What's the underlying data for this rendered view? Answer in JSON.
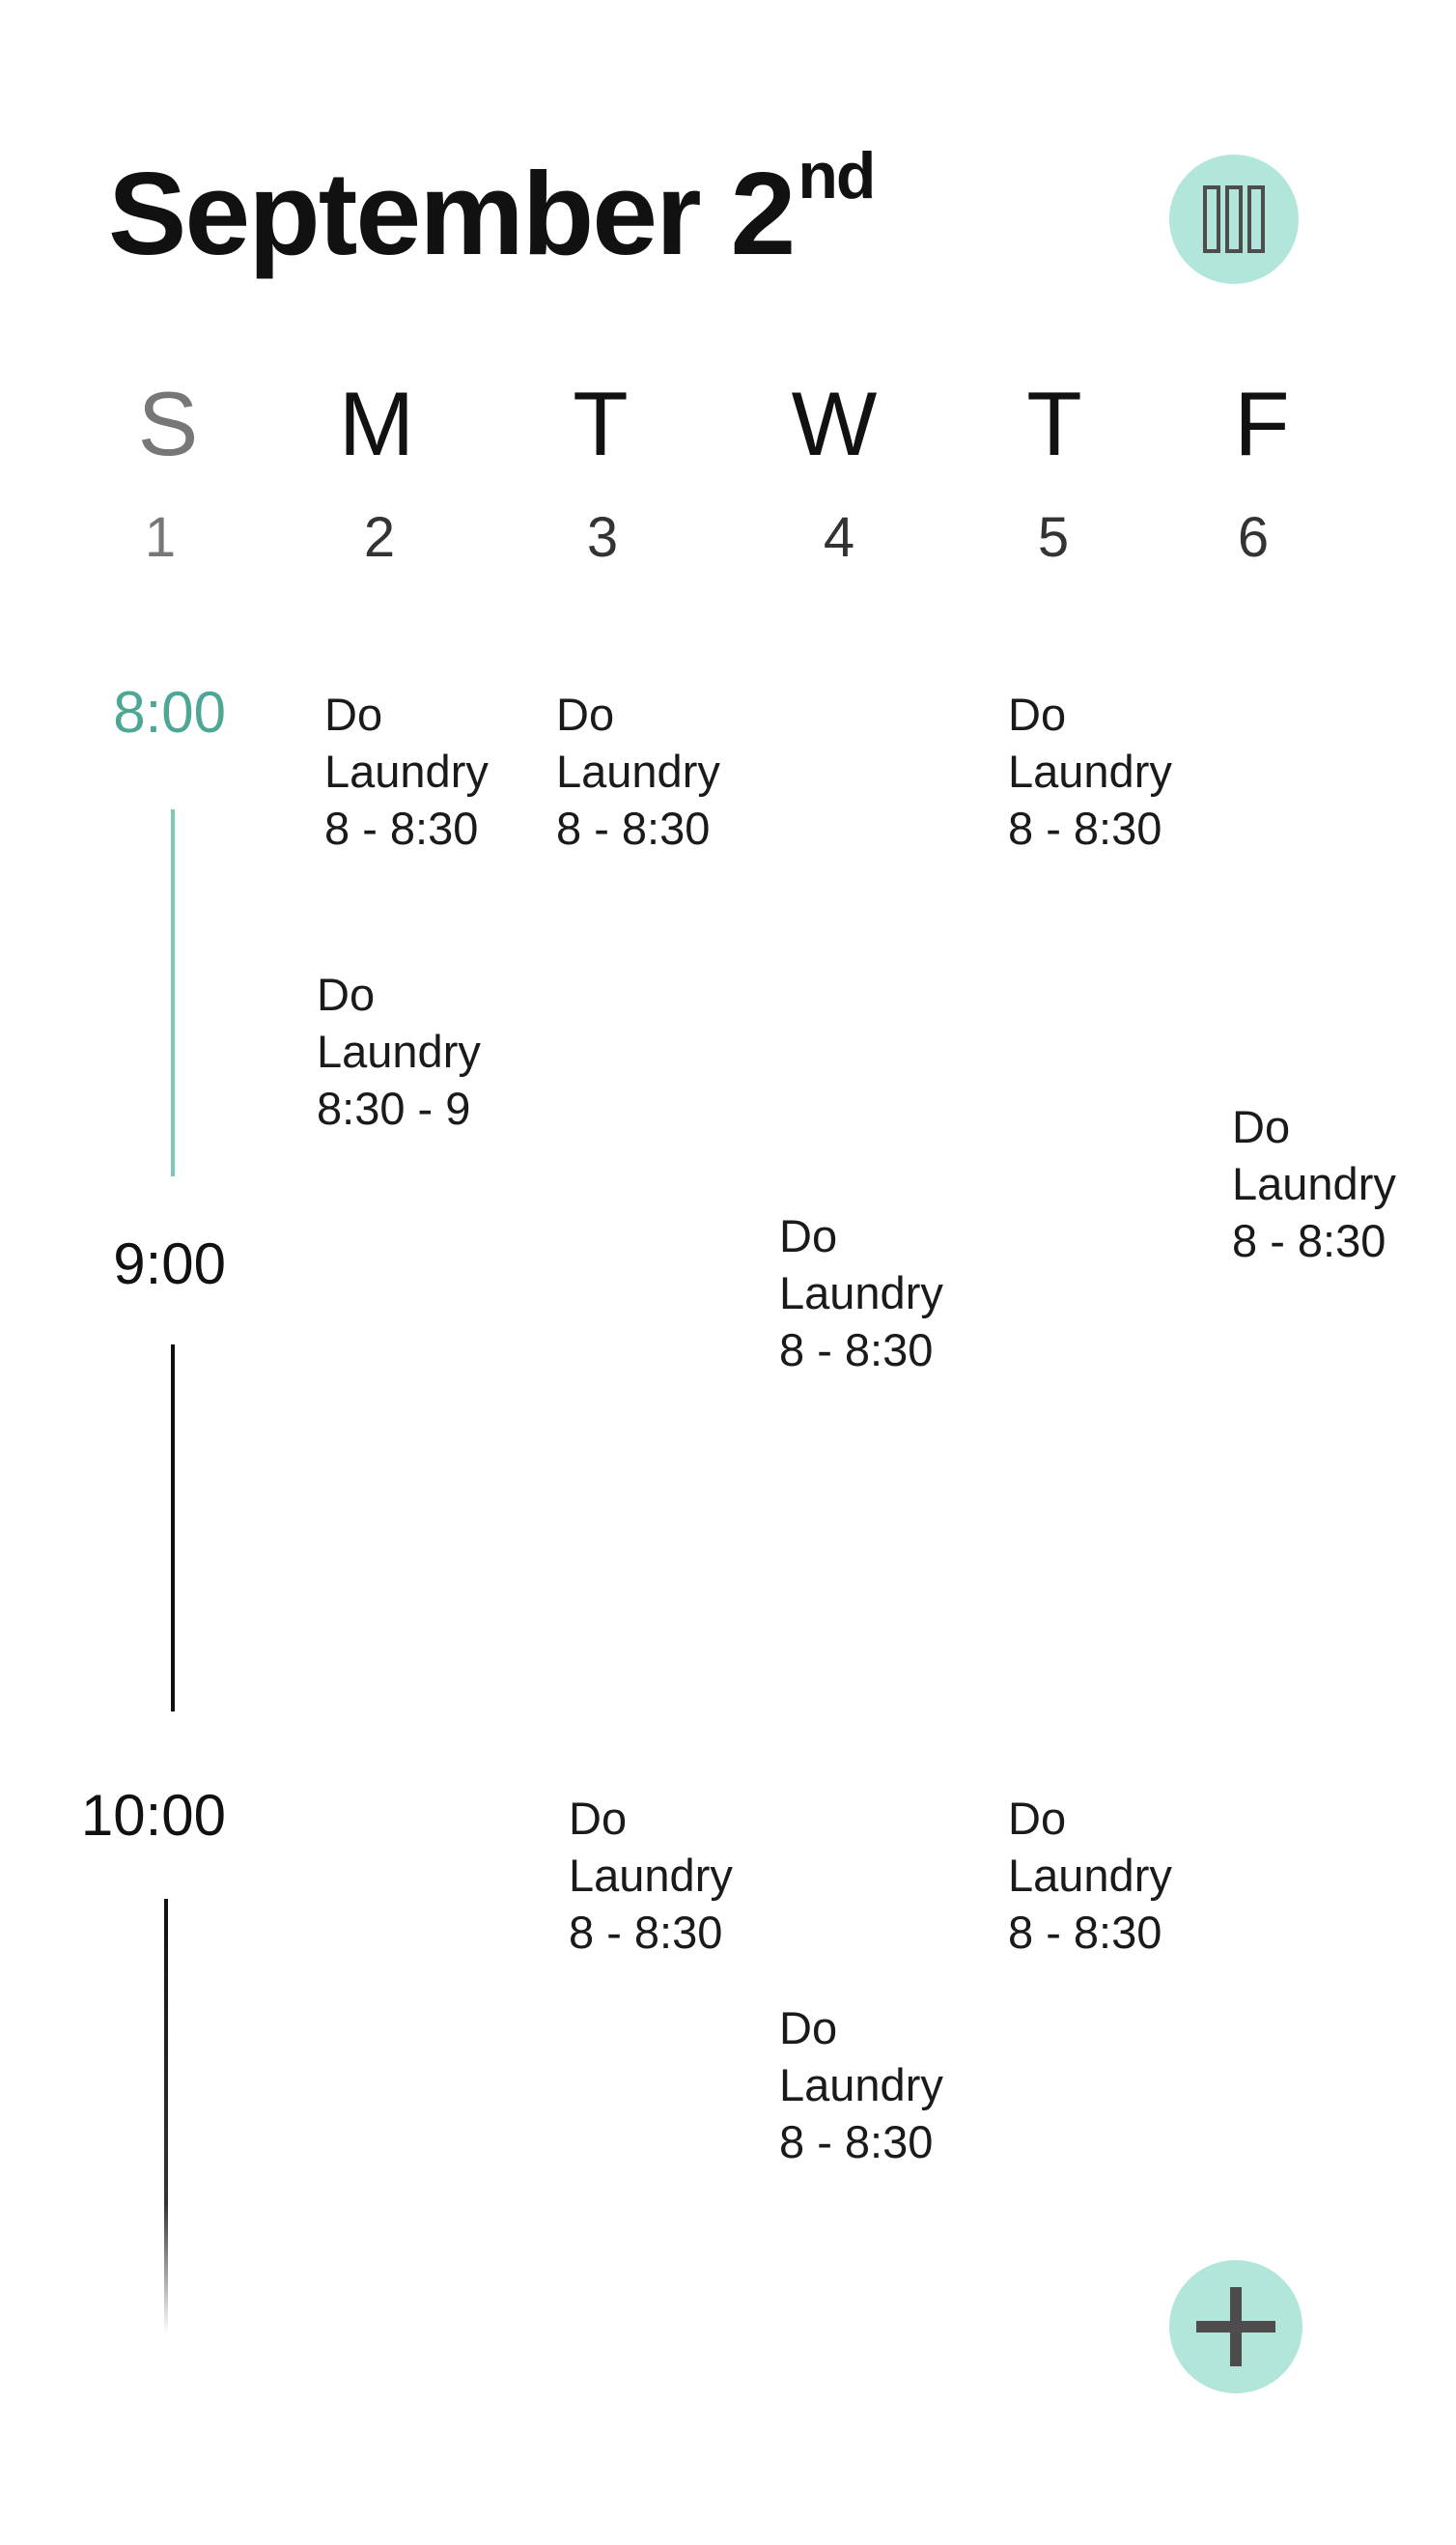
{
  "header": {
    "month_day": "September 2",
    "ordinal_suffix": "nd",
    "view_button_icon": "columns-icon"
  },
  "days": [
    {
      "letter": "S",
      "number": "1",
      "muted": true
    },
    {
      "letter": "M",
      "number": "2"
    },
    {
      "letter": "T",
      "number": "3"
    },
    {
      "letter": "W",
      "number": "4"
    },
    {
      "letter": "T",
      "number": "5"
    },
    {
      "letter": "F",
      "number": "6"
    }
  ],
  "times": [
    {
      "label": "8:00",
      "current": true
    },
    {
      "label": "9:00"
    },
    {
      "label": "10:00"
    }
  ],
  "events": [
    {
      "title_line1": "Do",
      "title_line2": "Laundry",
      "time": "8 - 8:30"
    },
    {
      "title_line1": "Do",
      "title_line2": "Laundry",
      "time": "8 - 8:30"
    },
    {
      "title_line1": "Do",
      "title_line2": "Laundry",
      "time": "8 - 8:30"
    },
    {
      "title_line1": "Do",
      "title_line2": "Laundry",
      "time": "8:30 - 9"
    },
    {
      "title_line1": "Do",
      "title_line2": "Laundry",
      "time": "8 - 8:30"
    },
    {
      "title_line1": "Do",
      "title_line2": "Laundry",
      "time": "8 - 8:30"
    },
    {
      "title_line1": "Do",
      "title_line2": "Laundry",
      "time": "8 - 8:30"
    },
    {
      "title_line1": "Do",
      "title_line2": "Laundry",
      "time": "8 - 8:30"
    },
    {
      "title_line1": "Do",
      "title_line2": "Laundry",
      "time": "8 - 8:30"
    }
  ],
  "colors": {
    "accent": "#4ea694",
    "button_bg": "#b2e6da",
    "icon": "#4d4d4d"
  },
  "fab": {
    "icon": "plus-icon"
  }
}
